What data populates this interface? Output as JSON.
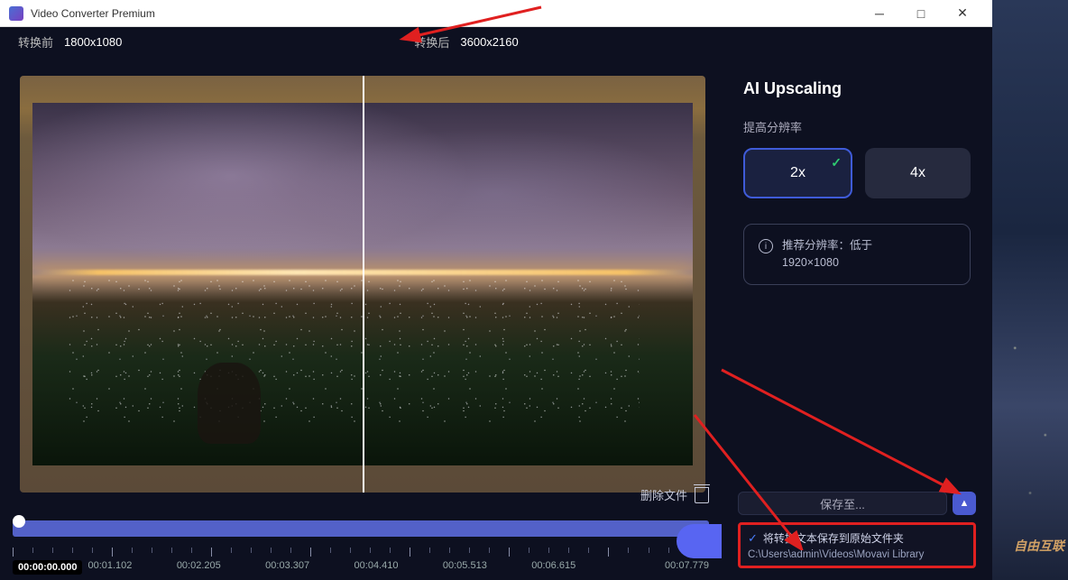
{
  "titlebar": {
    "title": "Video Converter Premium"
  },
  "resolution": {
    "before_label": "转换前",
    "before_value": "1800x1080",
    "after_label": "转换后",
    "after_value": "3600x2160"
  },
  "upscaling": {
    "title": "AI Upscaling",
    "subtitle": "提高分辨率",
    "option_2x": "2x",
    "option_4x": "4x",
    "info_line1": "推荐分辨率：低于",
    "info_line2": "1920×1080"
  },
  "bottom": {
    "delete_label": "删除文件"
  },
  "timeline": {
    "current": "00:00:00.000",
    "t1": "00:01.102",
    "t2": "00:02.205",
    "t3": "00:03.307",
    "t4": "00:04.410",
    "t5": "00:05.513",
    "t6": "00:06.615",
    "t7": "00:07.779"
  },
  "save": {
    "save_to": "保存至...",
    "checkbox_label": "将转换文本保存到原始文件夹",
    "path": "C:\\Users\\admin\\Videos\\Movavi Library"
  },
  "watermark": "自由互联"
}
